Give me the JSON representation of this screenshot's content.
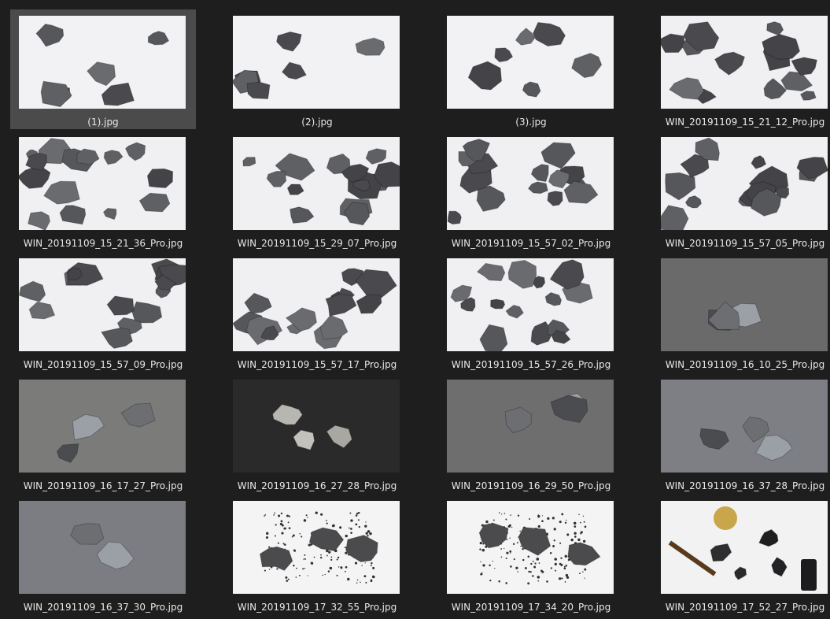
{
  "files": [
    {
      "name": "(1).jpg",
      "selected": true,
      "bg": "#f2f2f4",
      "scene": "white"
    },
    {
      "name": "(2).jpg",
      "selected": false,
      "bg": "#f2f2f4",
      "scene": "white"
    },
    {
      "name": "(3).jpg",
      "selected": false,
      "bg": "#f2f2f4",
      "scene": "white"
    },
    {
      "name": "WIN_20191109_15_21_12_Pro.jpg",
      "selected": false,
      "bg": "#f0f0f2",
      "scene": "white"
    },
    {
      "name": "WIN_20191109_15_21_36_Pro.jpg",
      "selected": false,
      "bg": "#f0f0f2",
      "scene": "white"
    },
    {
      "name": "WIN_20191109_15_29_07_Pro.jpg",
      "selected": false,
      "bg": "#f0f0f2",
      "scene": "white"
    },
    {
      "name": "WIN_20191109_15_57_02_Pro.jpg",
      "selected": false,
      "bg": "#f0f0f2",
      "scene": "white"
    },
    {
      "name": "WIN_20191109_15_57_05_Pro.jpg",
      "selected": false,
      "bg": "#f0f0f2",
      "scene": "white"
    },
    {
      "name": "WIN_20191109_15_57_09_Pro.jpg",
      "selected": false,
      "bg": "#f0f0f2",
      "scene": "white"
    },
    {
      "name": "WIN_20191109_15_57_17_Pro.jpg",
      "selected": false,
      "bg": "#f0f0f2",
      "scene": "white"
    },
    {
      "name": "WIN_20191109_15_57_26_Pro.jpg",
      "selected": false,
      "bg": "#f0f0f2",
      "scene": "white"
    },
    {
      "name": "WIN_20191109_16_10_25_Pro.jpg",
      "selected": false,
      "bg": "#6a6a6a",
      "scene": "gray"
    },
    {
      "name": "WIN_20191109_16_17_27_Pro.jpg",
      "selected": false,
      "bg": "#7b7b7a",
      "scene": "gray"
    },
    {
      "name": "WIN_20191109_16_27_28_Pro.jpg",
      "selected": false,
      "bg": "#2a2a2a",
      "scene": "dark"
    },
    {
      "name": "WIN_20191109_16_29_50_Pro.jpg",
      "selected": false,
      "bg": "#6e6e6e",
      "scene": "gray"
    },
    {
      "name": "WIN_20191109_16_37_28_Pro.jpg",
      "selected": false,
      "bg": "#7d7f85",
      "scene": "gray"
    },
    {
      "name": "WIN_20191109_16_37_30_Pro.jpg",
      "selected": false,
      "bg": "#7b7d82",
      "scene": "gray"
    },
    {
      "name": "WIN_20191109_17_32_55_Pro.jpg",
      "selected": false,
      "bg": "#f4f4f4",
      "scene": "dust"
    },
    {
      "name": "WIN_20191109_17_34_20_Pro.jpg",
      "selected": false,
      "bg": "#f4f4f4",
      "scene": "dust"
    },
    {
      "name": "WIN_20191109_17_52_27_Pro.jpg",
      "selected": false,
      "bg": "#f2f2f2",
      "scene": "objects"
    }
  ]
}
